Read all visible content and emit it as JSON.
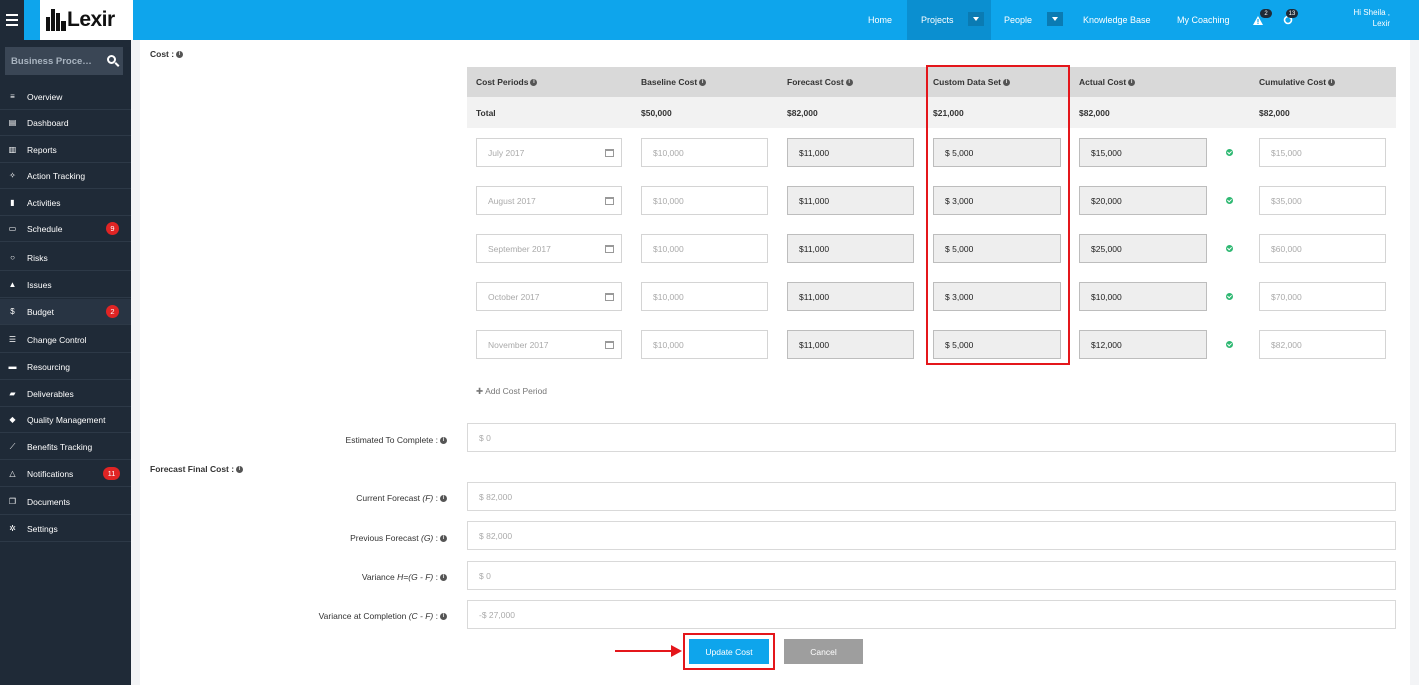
{
  "app": {
    "logo_text": "Lexir"
  },
  "nav": {
    "home": "Home",
    "projects": "Projects",
    "people": "People",
    "knowledge_base": "Knowledge Base",
    "my_coaching": "My Coaching",
    "alerts_count": "2",
    "tasks_count": "13",
    "user_greeting": "Hi Sheila ,",
    "user_org": "Lexir"
  },
  "sidebar": {
    "search_value": "Business Process...",
    "items": [
      {
        "label": "Overview",
        "icon": "list-icon"
      },
      {
        "label": "Dashboard",
        "icon": "dashboard-icon"
      },
      {
        "label": "Reports",
        "icon": "bar-chart-icon"
      },
      {
        "label": "Action Tracking",
        "icon": "target-icon"
      },
      {
        "label": "Activities",
        "icon": "bookmark-icon"
      },
      {
        "label": "Schedule",
        "icon": "calendar-icon",
        "badge": "9"
      },
      {
        "label": "Risks",
        "icon": "bulb-icon"
      },
      {
        "label": "Issues",
        "icon": "warning-icon"
      },
      {
        "label": "Budget",
        "icon": "dollar-icon",
        "badge": "2"
      },
      {
        "label": "Change Control",
        "icon": "layers-icon"
      },
      {
        "label": "Resourcing",
        "icon": "folder-icon"
      },
      {
        "label": "Deliverables",
        "icon": "truck-icon"
      },
      {
        "label": "Quality Management",
        "icon": "tag-icon"
      },
      {
        "label": "Benefits Tracking",
        "icon": "line-chart-icon"
      },
      {
        "label": "Notifications",
        "icon": "bell-icon",
        "badge": "11"
      },
      {
        "label": "Documents",
        "icon": "files-icon"
      },
      {
        "label": "Settings",
        "icon": "gears-icon"
      }
    ]
  },
  "cost": {
    "section_label": "Cost :",
    "headers": {
      "periods": "Cost Periods",
      "baseline": "Baseline Cost",
      "forecast": "Forecast Cost",
      "custom": "Custom Data Set",
      "actual": "Actual Cost",
      "cumulative": "Cumulative Cost"
    },
    "totals": {
      "label": "Total",
      "baseline": "$50,000",
      "forecast": "$82,000",
      "custom": "$21,000",
      "actual": "$82,000",
      "cumulative": "$82,000"
    },
    "rows": [
      {
        "period": "July 2017",
        "baseline": "$10,000",
        "forecast": "$11,000",
        "custom": "$ 5,000",
        "actual": "$15,000",
        "cumulative": "$15,000"
      },
      {
        "period": "August 2017",
        "baseline": "$10,000",
        "forecast": "$11,000",
        "custom": "$ 3,000",
        "actual": "$20,000",
        "cumulative": "$35,000"
      },
      {
        "period": "September 2017",
        "baseline": "$10,000",
        "forecast": "$11,000",
        "custom": "$ 5,000",
        "actual": "$25,000",
        "cumulative": "$60,000"
      },
      {
        "period": "October 2017",
        "baseline": "$10,000",
        "forecast": "$11,000",
        "custom": "$ 3,000",
        "actual": "$10,000",
        "cumulative": "$70,000"
      },
      {
        "period": "November 2017",
        "baseline": "$10,000",
        "forecast": "$11,000",
        "custom": "$ 5,000",
        "actual": "$12,000",
        "cumulative": "$82,000"
      }
    ],
    "add_period": "Add Cost Period"
  },
  "forecast": {
    "etc_label": "Estimated To Complete :",
    "etc_value": "$ 0",
    "ffc_label": "Forecast Final Cost :",
    "current_label": "Current Forecast",
    "current_formula": "(F)",
    "current_value": "$ 82,000",
    "previous_label": "Previous Forecast",
    "previous_formula": "(G)",
    "previous_value": "$ 82,000",
    "variance_label": "Variance",
    "variance_formula": "H=(G - F)",
    "variance_value": "$ 0",
    "vac_label": "Variance at Completion",
    "vac_formula": "(C - F)",
    "vac_value": "-$ 27,000"
  },
  "actions": {
    "update": "Update Cost",
    "cancel": "Cancel"
  },
  "colors": {
    "brand": "#0ea5ec",
    "sidebar": "#1f2a37",
    "highlight": "#e4161b",
    "badge": "#e02424",
    "success": "#2eb872"
  }
}
